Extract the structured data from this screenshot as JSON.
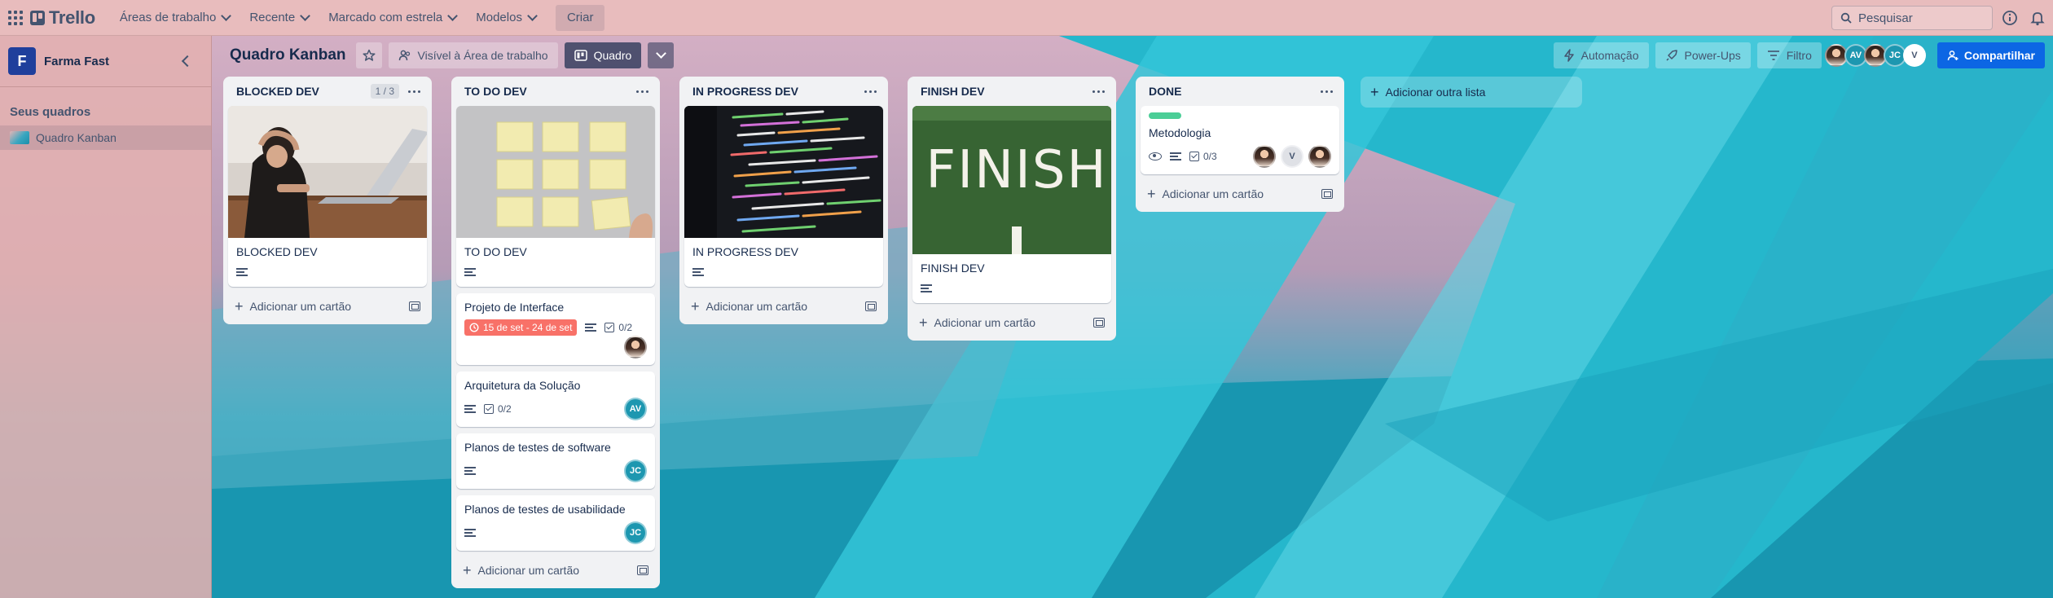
{
  "topbar": {
    "app_name": "Trello",
    "nav": [
      {
        "label": "Áreas de trabalho"
      },
      {
        "label": "Recente"
      },
      {
        "label": "Marcado com estrela"
      },
      {
        "label": "Modelos"
      }
    ],
    "create_label": "Criar",
    "search_placeholder": "Pesquisar"
  },
  "sidebar": {
    "workspace_initial": "F",
    "workspace_name": "Farma Fast",
    "section_title": "Seus quadros",
    "boards": [
      {
        "label": "Quadro Kanban"
      }
    ]
  },
  "board": {
    "title": "Quadro Kanban",
    "visibility_label": "Visível à Área de trabalho",
    "view_label": "Quadro",
    "automation_label": "Automação",
    "powerups_label": "Power-Ups",
    "filter_label": "Filtro",
    "share_label": "Compartilhar",
    "members": [
      "AV",
      "JC",
      "V"
    ]
  },
  "lists": [
    {
      "title": "BLOCKED DEV",
      "limit": "1 / 3",
      "cards": [
        {
          "title": "BLOCKED DEV",
          "cover": "stressed-person-laptop"
        }
      ],
      "add_label": "Adicionar um cartão"
    },
    {
      "title": "TO DO DEV",
      "cards": [
        {
          "title": "TO DO DEV",
          "cover": "sticky-notes-wall"
        },
        {
          "title": "Projeto de Interface",
          "date": "15 de set - 24 de set",
          "checklist": "0/2",
          "member": "photo"
        },
        {
          "title": "Arquitetura da Solução",
          "checklist": "0/2",
          "member": "AV"
        },
        {
          "title": "Planos de testes de software",
          "member": "JC"
        },
        {
          "title": "Planos de testes de usabilidade",
          "member": "JC"
        }
      ],
      "add_label": "Adicionar um cartão"
    },
    {
      "title": "IN PROGRESS DEV",
      "cards": [
        {
          "title": "IN PROGRESS DEV",
          "cover": "code-on-screen"
        }
      ],
      "add_label": "Adicionar um cartão"
    },
    {
      "title": "FINISH DEV",
      "cards": [
        {
          "title": "FINISH DEV",
          "cover": "finish-line-grass",
          "cover_text": "FINISH"
        }
      ],
      "add_label": "Adicionar um cartão"
    },
    {
      "title": "DONE",
      "cards": [
        {
          "title": "Metodologia",
          "checklist": "0/3",
          "label_color": "#4bce97",
          "members": [
            "photo",
            "V",
            "photo"
          ]
        }
      ],
      "add_label": "Adicionar um cartão"
    }
  ],
  "add_list_label": "Adicionar outra lista",
  "colors": {
    "accent": "#0c66e4",
    "date_badge": "#f87168",
    "avatar_teal": "#1d97b0",
    "workspace_logo": "#1f3f9c"
  }
}
